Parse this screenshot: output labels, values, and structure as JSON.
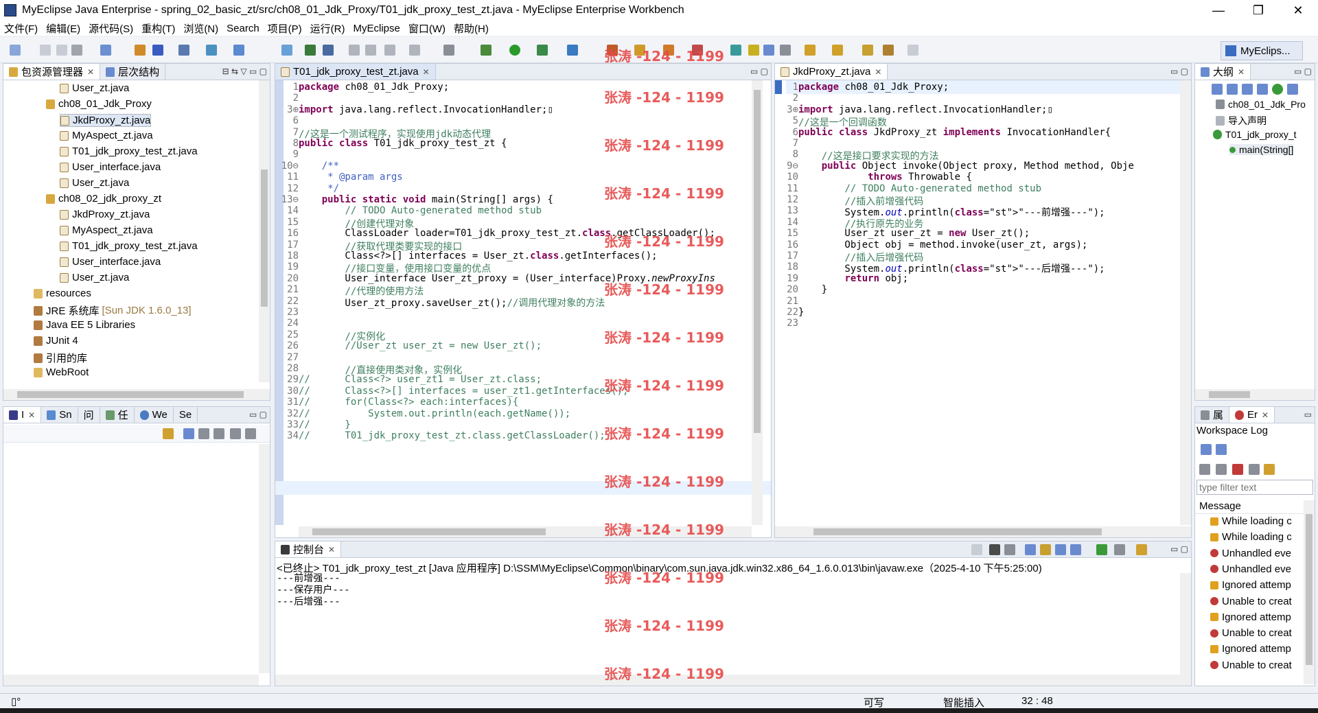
{
  "window": {
    "title": "MyEclipse Java Enterprise  -  spring_02_basic_zt/src/ch08_01_Jdk_Proxy/T01_jdk_proxy_test_zt.java  -  MyEclipse Enterprise Workbench",
    "minimize": "—",
    "maximize": "❐",
    "close": "✕"
  },
  "menu": [
    "文件(F)",
    "编辑(E)",
    "源代码(S)",
    "重构(T)",
    "浏览(N)",
    "Search",
    "项目(P)",
    "运行(R)",
    "MyEclipse",
    "窗口(W)",
    "帮助(H)"
  ],
  "perspective": "MyEclips...",
  "left_panel": {
    "tabs": [
      "包资源管理器",
      "层次结构"
    ],
    "items": [
      "User_zt.java",
      "ch08_01_Jdk_Proxy",
      "JkdProxy_zt.java",
      "MyAspect_zt.java",
      "T01_jdk_proxy_test_zt.java",
      "User_interface.java",
      "User_zt.java",
      "ch08_02_jdk_proxy_zt",
      "JkdProxy_zt.java",
      "MyAspect_zt.java",
      "T01_jdk_proxy_test_zt.java",
      "User_interface.java",
      "User_zt.java",
      "resources",
      "JRE 系统库",
      "Java EE 5 Libraries",
      "JUnit 4",
      "引用的库",
      "WebRoot"
    ],
    "jre_suffix": "[Sun JDK 1.6.0_13]"
  },
  "left_bottom_tabs": [
    "I",
    "Sn",
    "问",
    "任",
    "We",
    "Se"
  ],
  "editor1": {
    "tab": "T01_jdk_proxy_test_zt.java",
    "lines": [
      {
        "n": "1",
        "t": "package ch08_01_Jdk_Proxy;"
      },
      {
        "n": "2",
        "t": ""
      },
      {
        "n": "3⊕",
        "t": "import java.lang.reflect.InvocationHandler;▯"
      },
      {
        "n": "6",
        "t": ""
      },
      {
        "n": "7",
        "t": "//这是一个测试程序，实现使用jdk动态代理"
      },
      {
        "n": "8",
        "t": "public class T01_jdk_proxy_test_zt {"
      },
      {
        "n": "9",
        "t": ""
      },
      {
        "n": "10⊖",
        "t": "    /**"
      },
      {
        "n": "11",
        "t": "     * @param args"
      },
      {
        "n": "12",
        "t": "     */"
      },
      {
        "n": "13⊖",
        "t": "    public static void main(String[] args) {"
      },
      {
        "n": "14",
        "t": "        // TODO Auto-generated method stub"
      },
      {
        "n": "15",
        "t": "        //创建代理对象"
      },
      {
        "n": "16",
        "t": "        ClassLoader loader=T01_jdk_proxy_test_zt.class.getClassLoader();"
      },
      {
        "n": "17",
        "t": "        //获取代理类要实现的接口"
      },
      {
        "n": "18",
        "t": "        Class<?>[] interfaces = User_zt.class.getInterfaces();"
      },
      {
        "n": "19",
        "t": "        //接口变量，使用接口变量的优点"
      },
      {
        "n": "20",
        "t": "        User_interface User_zt_proxy = (User_interface)Proxy.newProxyIns"
      },
      {
        "n": "21",
        "t": "        //代理的使用方法"
      },
      {
        "n": "22",
        "t": "        User_zt_proxy.saveUser_zt();//调用代理对象的方法"
      },
      {
        "n": "23",
        "t": ""
      },
      {
        "n": "24",
        "t": ""
      },
      {
        "n": "25",
        "t": "        //实例化"
      },
      {
        "n": "26",
        "t": "        //User_zt user_zt = new User_zt();"
      },
      {
        "n": "27",
        "t": ""
      },
      {
        "n": "28",
        "t": "        //直接使用类对象，实例化"
      },
      {
        "n": "29",
        "t": "//      Class<?> user_zt1 = User_zt.class;"
      },
      {
        "n": "30",
        "t": "//      Class<?>[] interfaces = user_zt1.getInterfaces();"
      },
      {
        "n": "31",
        "t": "//      for(Class<?> each:interfaces){"
      },
      {
        "n": "32",
        "t": "//          System.out.println(each.getName());"
      },
      {
        "n": "33",
        "t": "//      }"
      },
      {
        "n": "34",
        "t": "//      T01_jdk_proxy_test_zt.class.getClassLoader();"
      }
    ]
  },
  "editor2": {
    "tab": "JkdProxy_zt.java",
    "lines": [
      {
        "n": "1",
        "t": "package ch08_01_Jdk_Proxy;"
      },
      {
        "n": "2",
        "t": ""
      },
      {
        "n": "3⊕",
        "t": "import java.lang.reflect.InvocationHandler;▯"
      },
      {
        "n": "5",
        "t": "//这是一个回调函数"
      },
      {
        "n": "6",
        "t": "public class JkdProxy_zt implements InvocationHandler{"
      },
      {
        "n": "7",
        "t": ""
      },
      {
        "n": "8",
        "t": "    //这是接口要求实现的方法"
      },
      {
        "n": "9⊖",
        "t": "    public Object invoke(Object proxy, Method method, Obje"
      },
      {
        "n": "10",
        "t": "            throws Throwable {"
      },
      {
        "n": "11",
        "t": "        // TODO Auto-generated method stub"
      },
      {
        "n": "12",
        "t": "        //插入前增强代码"
      },
      {
        "n": "13",
        "t": "        System.out.println(\"---前增强---\");"
      },
      {
        "n": "14",
        "t": "        //执行原先的业务"
      },
      {
        "n": "15",
        "t": "        User_zt user_zt = new User_zt();"
      },
      {
        "n": "16",
        "t": "        Object obj = method.invoke(user_zt, args);"
      },
      {
        "n": "17",
        "t": "        //插入后增强代码"
      },
      {
        "n": "18",
        "t": "        System.out.println(\"---后增强---\");"
      },
      {
        "n": "19",
        "t": "        return obj;"
      },
      {
        "n": "20",
        "t": "    }"
      },
      {
        "n": "21",
        "t": ""
      },
      {
        "n": "22",
        "t": "}"
      },
      {
        "n": "23",
        "t": ""
      }
    ]
  },
  "outline": {
    "tab": "大纲",
    "items": [
      "ch08_01_Jdk_Pro",
      "导入声明",
      "T01_jdk_proxy_t",
      "main(String[]"
    ]
  },
  "errorlog": {
    "tabs": [
      "属",
      "Er"
    ],
    "title": "Workspace Log",
    "filter_placeholder": "type filter text",
    "column": "Message",
    "messages": [
      "While loading c",
      "While loading c",
      "Unhandled eve",
      "Unhandled eve",
      "Ignored attemp",
      "Unable to creat",
      "Ignored attemp",
      "Unable to creat",
      "Ignored attemp",
      "Unable to creat"
    ]
  },
  "console": {
    "tab": "控制台",
    "header": "<已终止> T01_jdk_proxy_test_zt [Java 应用程序] D:\\SSM\\MyEclipse\\Common\\binary\\com.sun.java.jdk.win32.x86_64_1.6.0.013\\bin\\javaw.exe（2025-4-10 下午5:25:00)",
    "output": [
      "---前增强---",
      "---保存用户---",
      "---后增强---"
    ]
  },
  "status": {
    "writable": "可写",
    "insert": "智能插入",
    "position": "32 : 48"
  },
  "watermark": "张涛 -124 - 1199",
  "colors": {
    "accent": "#3a6cc0",
    "watermark": "#e64a4a",
    "keyword": "#7f0055",
    "comment": "#3f7f5f",
    "string": "#2a00ff"
  }
}
